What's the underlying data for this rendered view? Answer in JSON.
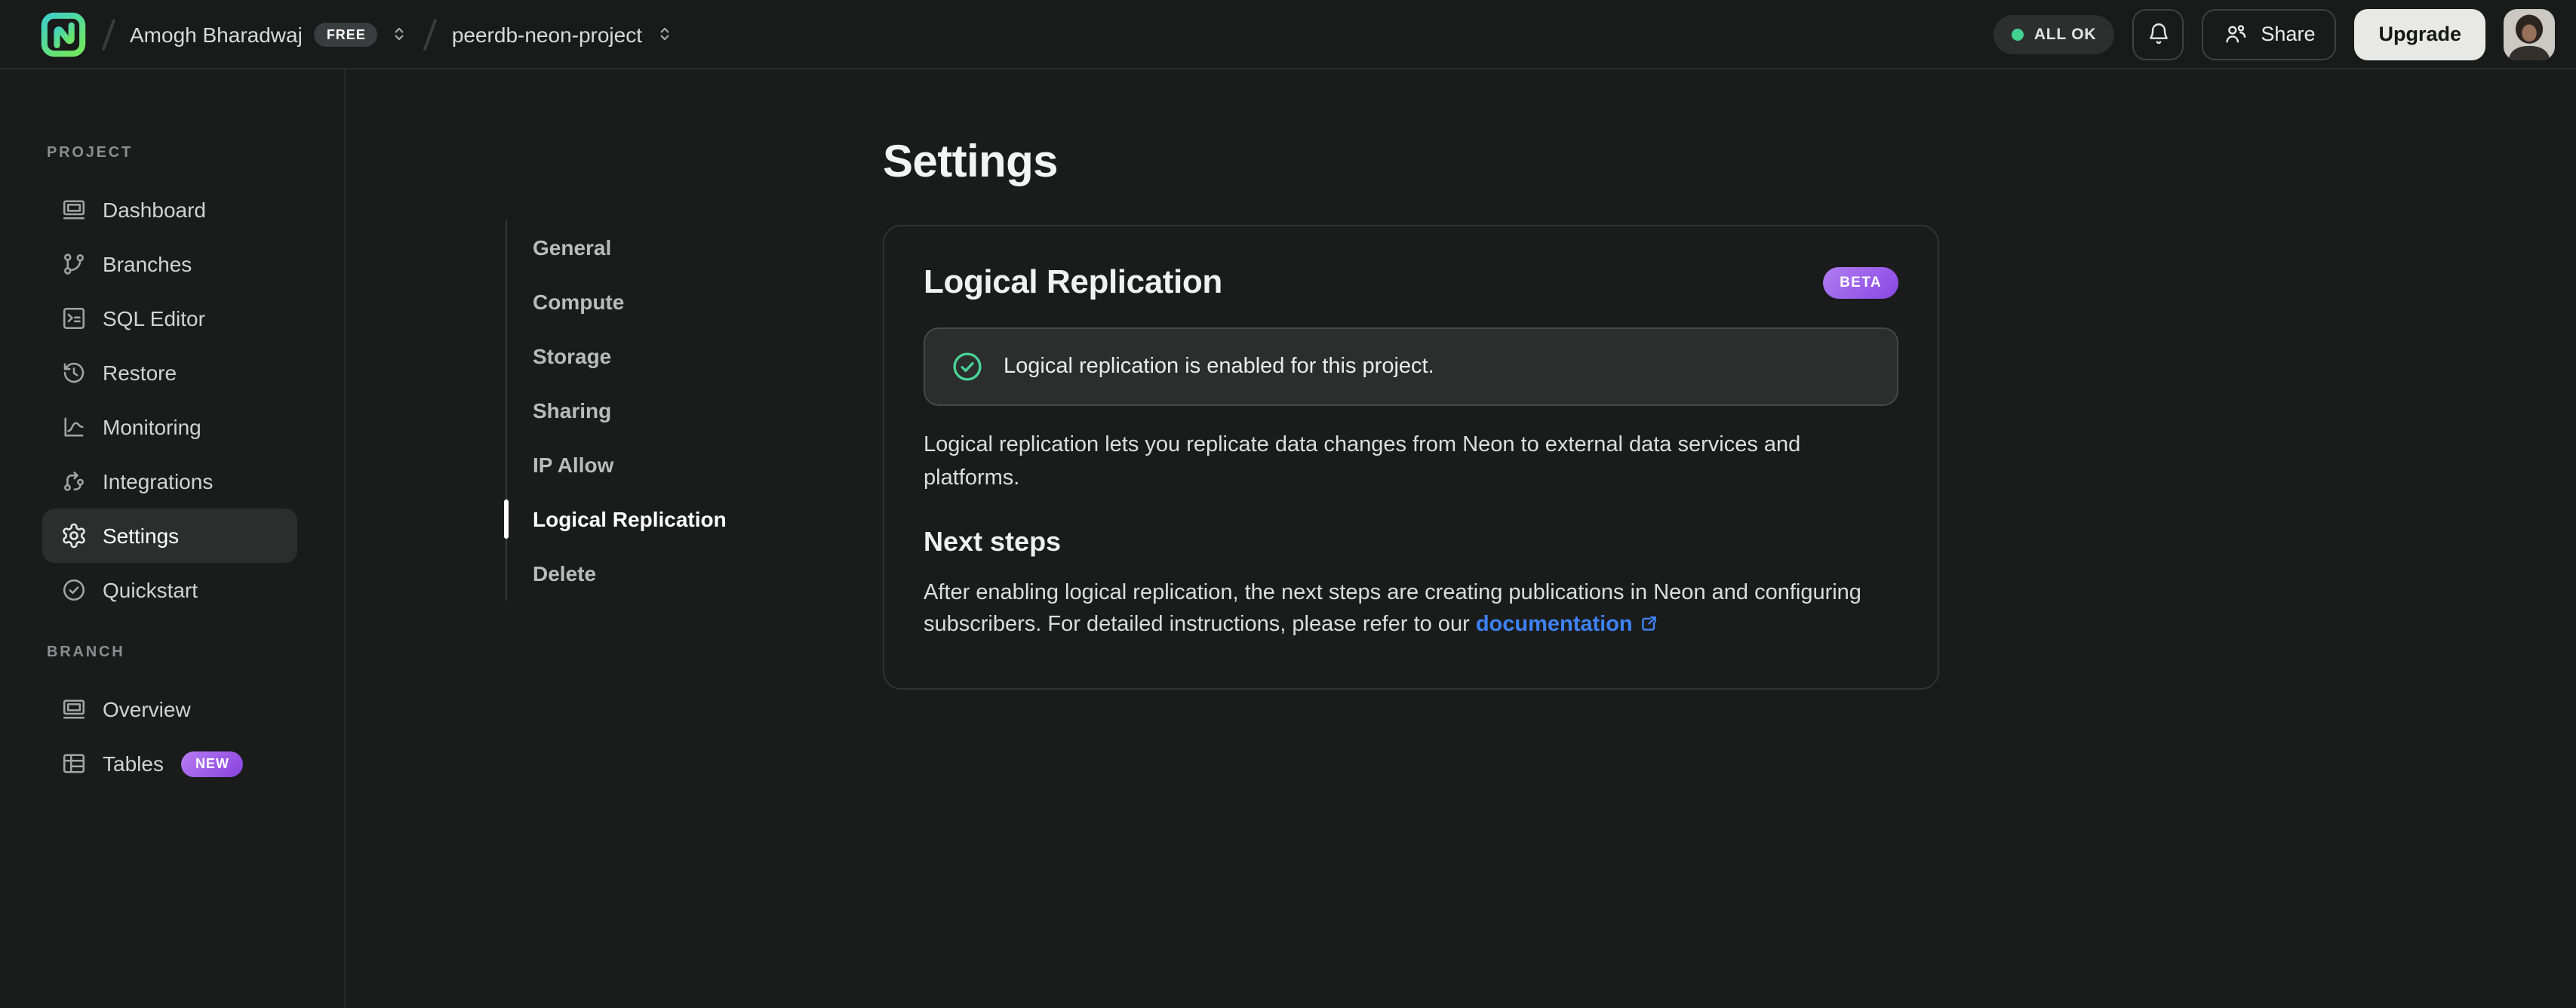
{
  "colors": {
    "background": "#1a1b1b",
    "topbar_background": "#191a1a",
    "border": "#2b2d2d",
    "accent_green": "#42d18e",
    "badge_purple_start": "#b07df2",
    "badge_purple_end": "#8747e2",
    "link_blue": "#3e82f7",
    "upgrade_button_background": "#e8e8e6"
  },
  "topbar": {
    "logo_icon": "neon-logo",
    "org": {
      "name": "Amogh Bharadwaj",
      "plan_badge": "FREE",
      "selector_icon": "chevron-up-down-icon"
    },
    "project": {
      "name": "peerdb-neon-project",
      "selector_icon": "chevron-up-down-icon"
    },
    "status": {
      "label": "ALL OK",
      "dot_color": "#42d18e"
    },
    "notifications_icon": "bell-icon",
    "share": {
      "label": "Share",
      "icon": "people-icon"
    },
    "upgrade_label": "Upgrade",
    "avatar_icon": "user-avatar-photo"
  },
  "sidebar": {
    "sections": [
      {
        "label": "PROJECT",
        "items": [
          {
            "label": "Dashboard",
            "icon": "dashboard-window-icon",
            "active": false
          },
          {
            "label": "Branches",
            "icon": "git-branch-icon",
            "active": false
          },
          {
            "label": "SQL Editor",
            "icon": "terminal-icon",
            "active": false
          },
          {
            "label": "Restore",
            "icon": "history-clock-icon",
            "active": false
          },
          {
            "label": "Monitoring",
            "icon": "line-chart-icon",
            "active": false
          },
          {
            "label": "Integrations",
            "icon": "workflow-icon",
            "active": false
          },
          {
            "label": "Settings",
            "icon": "gear-icon",
            "active": true
          },
          {
            "label": "Quickstart",
            "icon": "check-circle-icon",
            "active": false
          }
        ]
      },
      {
        "label": "BRANCH",
        "items": [
          {
            "label": "Overview",
            "icon": "dashboard-window-icon",
            "active": false
          },
          {
            "label": "Tables",
            "icon": "table-icon",
            "active": false,
            "badge": "NEW"
          }
        ]
      }
    ]
  },
  "settings_nav": {
    "items": [
      {
        "label": "General",
        "active": false
      },
      {
        "label": "Compute",
        "active": false
      },
      {
        "label": "Storage",
        "active": false
      },
      {
        "label": "Sharing",
        "active": false
      },
      {
        "label": "IP Allow",
        "active": false
      },
      {
        "label": "Logical Replication",
        "active": true
      },
      {
        "label": "Delete",
        "active": false
      }
    ]
  },
  "main": {
    "page_title": "Settings",
    "card": {
      "title": "Logical Replication",
      "beta_badge": "BETA",
      "status_alert": {
        "icon": "check-circle-icon",
        "text": "Logical replication is enabled for this project."
      },
      "description": "Logical replication lets you replicate data changes from Neon to external data services and platforms.",
      "next_steps_heading": "Next steps",
      "next_steps_text": "After enabling logical replication, the next steps are creating publications in Neon and configuring subscribers. For detailed instructions, please refer to our",
      "documentation_link": {
        "label": "documentation",
        "icon": "external-link-icon"
      }
    }
  }
}
